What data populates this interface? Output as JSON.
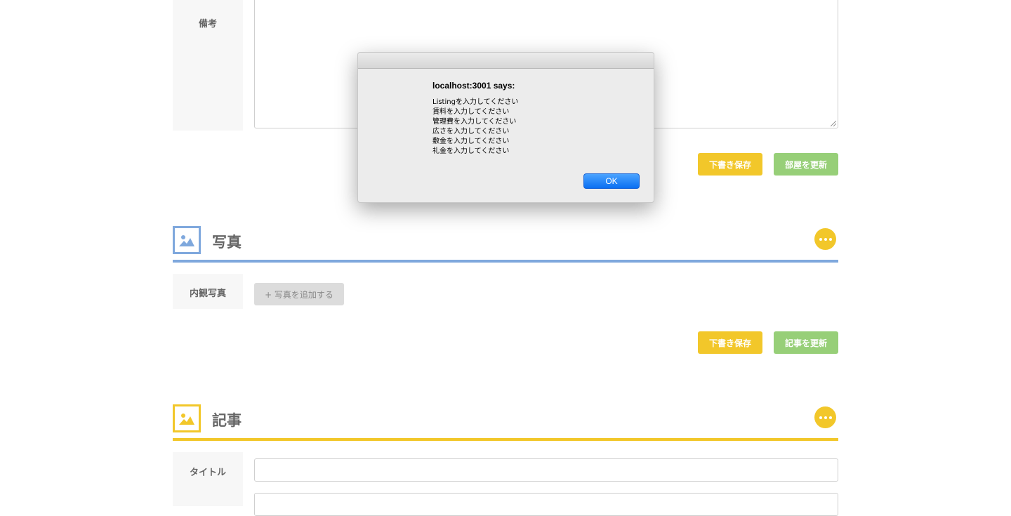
{
  "notes_section": {
    "label": "備考",
    "save_draft_label": "下書き保存",
    "update_label": "部屋を更新"
  },
  "photos_section": {
    "title": "写真",
    "row_label": "内観写真",
    "add_photo_label": "+ 写真を追加する",
    "save_draft_label": "下書き保存",
    "update_label": "記事を更新",
    "accent_color": "#7fa8dd"
  },
  "article_section": {
    "title": "記事",
    "title_label": "タイトル",
    "accent_color": "#f2c72a"
  },
  "dialog": {
    "title": "localhost:3001 says:",
    "messages": [
      "Listingを入力してください",
      "賃料を入力してください",
      "管理費を入力してください",
      "広さを入力してください",
      "敷金を入力してください",
      "礼金を入力してください"
    ],
    "ok_label": "OK"
  }
}
